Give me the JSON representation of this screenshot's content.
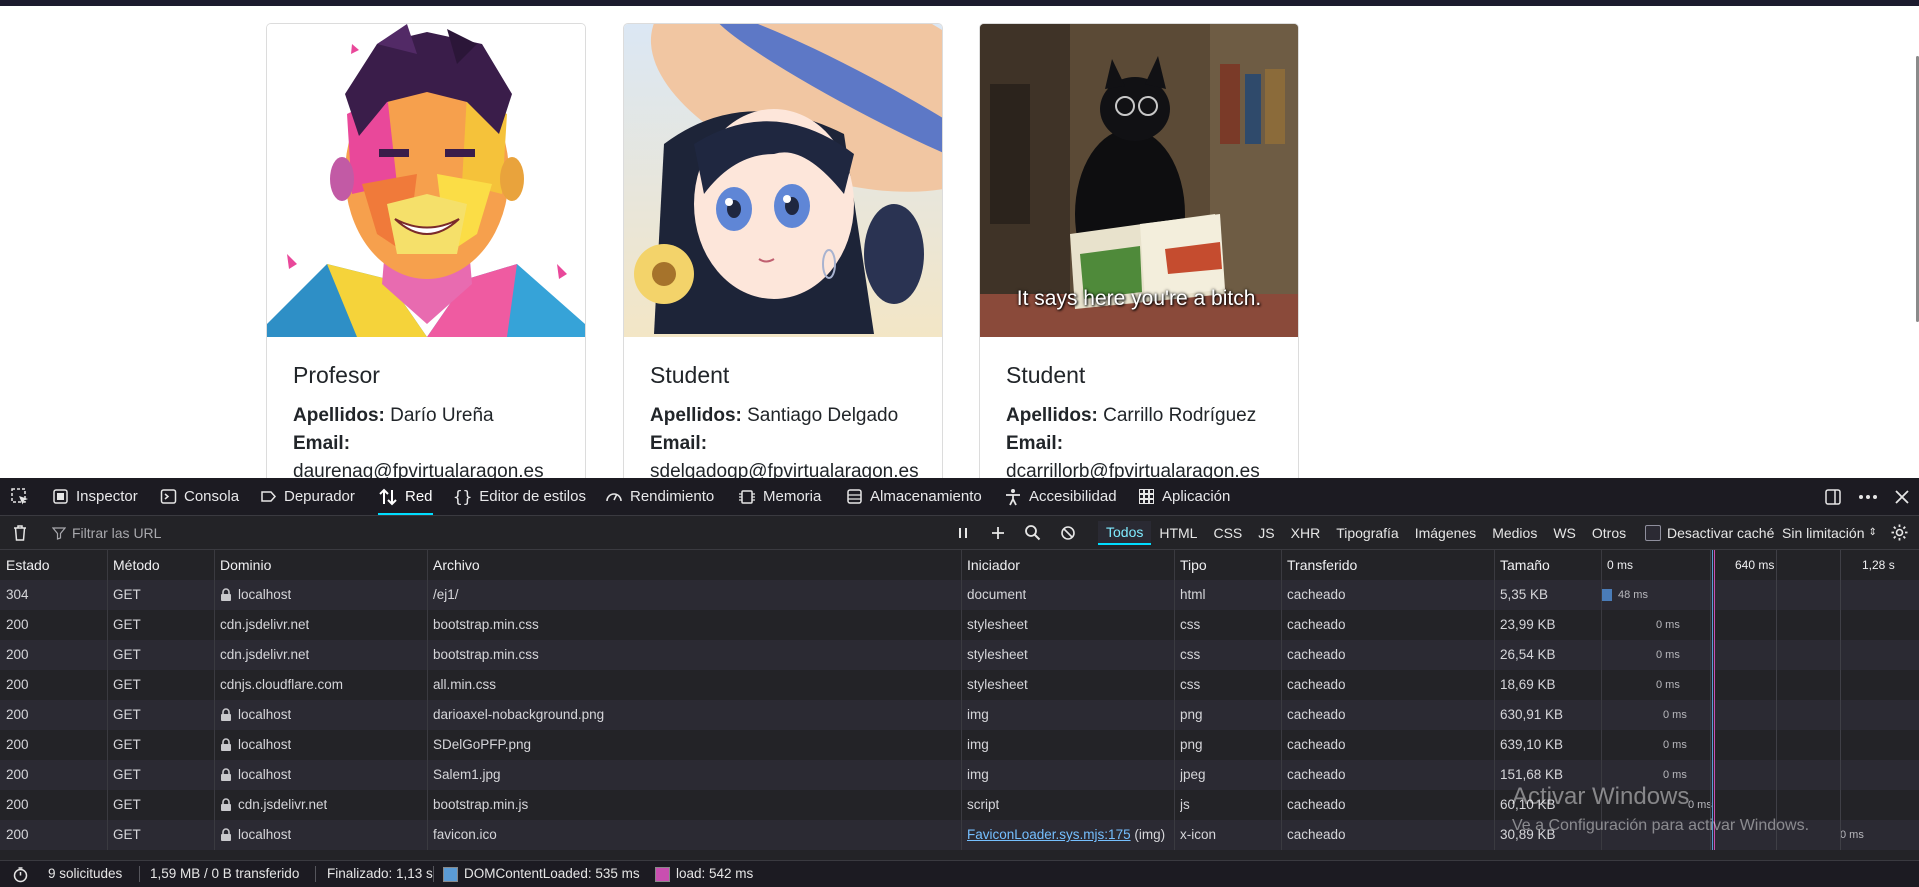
{
  "cards": [
    {
      "role": "Profesor",
      "apellidos_label": "Apellidos:",
      "apellidos": "Darío Ureña",
      "email_label": "Email:",
      "email": "daurenag@fpvirtualaragon.es"
    },
    {
      "role": "Student",
      "apellidos_label": "Apellidos:",
      "apellidos": "Santiago Delgado",
      "email_label": "Email:",
      "email": "sdelgadogp@fpvirtualaragon.es"
    },
    {
      "role": "Student",
      "apellidos_label": "Apellidos:",
      "apellidos": "Carrillo Rodríguez",
      "email_label": "Email:",
      "email": "dcarrillorb@fpvirtualaragon.es",
      "image_caption": "It says here you're a bitch."
    }
  ],
  "devtools": {
    "tabs": [
      "Inspector",
      "Consola",
      "Depurador",
      "Red",
      "Editor de estilos",
      "Rendimiento",
      "Memoria",
      "Almacenamiento",
      "Accesibilidad",
      "Aplicación"
    ],
    "active_tab": "Red",
    "filter_placeholder": "Filtrar las URL",
    "type_filters": [
      "Todos",
      "HTML",
      "CSS",
      "JS",
      "XHR",
      "Tipografía",
      "Imágenes",
      "Medios",
      "WS",
      "Otros"
    ],
    "active_type": "Todos",
    "disable_cache_label": "Desactivar caché",
    "throttle_label": "Sin limitación",
    "columns": [
      "Estado",
      "Método",
      "Dominio",
      "Archivo",
      "Iniciador",
      "Tipo",
      "Transferido",
      "Tamaño"
    ],
    "waterfall_ticks": [
      "0 ms",
      "640 ms",
      "1,28 s"
    ],
    "rows": [
      {
        "estado": "304",
        "metodo": "GET",
        "dominio": "localhost",
        "lock": true,
        "archivo": "/ej1/",
        "iniciador": "document",
        "tipo": "html",
        "transferido": "cacheado",
        "tamano": "5,35 KB",
        "timing": "48 ms"
      },
      {
        "estado": "200",
        "metodo": "GET",
        "dominio": "cdn.jsdelivr.net",
        "lock": false,
        "archivo": "bootstrap.min.css",
        "iniciador": "stylesheet",
        "tipo": "css",
        "transferido": "cacheado",
        "tamano": "23,99 KB",
        "timing": "0 ms"
      },
      {
        "estado": "200",
        "metodo": "GET",
        "dominio": "cdn.jsdelivr.net",
        "lock": false,
        "archivo": "bootstrap.min.css",
        "iniciador": "stylesheet",
        "tipo": "css",
        "transferido": "cacheado",
        "tamano": "26,54 KB",
        "timing": "0 ms"
      },
      {
        "estado": "200",
        "metodo": "GET",
        "dominio": "cdnjs.cloudflare.com",
        "lock": false,
        "archivo": "all.min.css",
        "iniciador": "stylesheet",
        "tipo": "css",
        "transferido": "cacheado",
        "tamano": "18,69 KB",
        "timing": "0 ms"
      },
      {
        "estado": "200",
        "metodo": "GET",
        "dominio": "localhost",
        "lock": true,
        "archivo": "darioaxel-nobackground.png",
        "iniciador": "img",
        "tipo": "png",
        "transferido": "cacheado",
        "tamano": "630,91 KB",
        "timing": "0 ms"
      },
      {
        "estado": "200",
        "metodo": "GET",
        "dominio": "localhost",
        "lock": true,
        "archivo": "SDelGoPFP.png",
        "iniciador": "img",
        "tipo": "png",
        "transferido": "cacheado",
        "tamano": "639,10 KB",
        "timing": "0 ms"
      },
      {
        "estado": "200",
        "metodo": "GET",
        "dominio": "localhost",
        "lock": true,
        "archivo": "Salem1.jpg",
        "iniciador": "img",
        "tipo": "jpeg",
        "transferido": "cacheado",
        "tamano": "151,68 KB",
        "timing": "0 ms"
      },
      {
        "estado": "200",
        "metodo": "GET",
        "dominio": "cdn.jsdelivr.net",
        "lock": true,
        "archivo": "bootstrap.min.js",
        "iniciador": "script",
        "tipo": "js",
        "transferido": "cacheado",
        "tamano": "60,10 KB",
        "timing": "0 ms"
      },
      {
        "estado": "200",
        "metodo": "GET",
        "dominio": "localhost",
        "lock": true,
        "archivo": "favicon.ico",
        "iniciador": "FaviconLoader.sys.mjs:175",
        "iniciador_suffix": "(img)",
        "tipo": "x-icon",
        "transferido": "cacheado",
        "tamano": "30,89 KB",
        "timing": "0 ms"
      }
    ],
    "status": {
      "requests": "9 solicitudes",
      "transferred": "1,59 MB / 0 B transferido",
      "finished": "Finalizado: 1,13 s",
      "domcontentloaded": "DOMContentLoaded: 535 ms",
      "load": "load: 542 ms",
      "dcl_color": "#5b9bd5",
      "load_color": "#c94fb0"
    }
  },
  "watermark": {
    "title": "Activar Windows",
    "subtitle": "Ve a Configuración para activar Windows."
  }
}
